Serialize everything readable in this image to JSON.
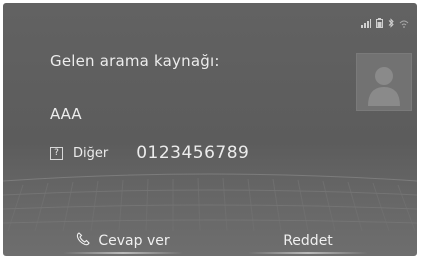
{
  "status": {
    "icons": [
      "signal-icon",
      "battery-icon",
      "bluetooth-icon",
      "wifi-icon"
    ]
  },
  "call": {
    "title": "Gelen arama kaynağı:",
    "caller_name": "AAA",
    "number_type": "Diğer",
    "number": "0123456789"
  },
  "buttons": {
    "answer": "Cevap ver",
    "decline": "Reddet"
  },
  "colors": {
    "background": "#626262",
    "text": "#ececec"
  }
}
